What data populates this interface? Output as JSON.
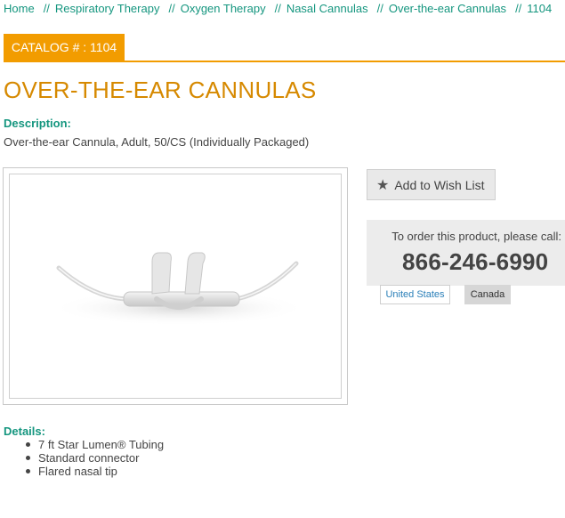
{
  "breadcrumb": {
    "items": [
      "Home",
      "Respiratory Therapy",
      "Oxygen Therapy",
      "Nasal Cannulas",
      "Over-the-ear Cannulas",
      "1104"
    ],
    "separator": "//"
  },
  "catalog": {
    "label": "CATALOG # : 1104"
  },
  "product": {
    "title": "OVER-THE-EAR CANNULAS",
    "description_label": "Description:",
    "description": "Over-the-ear Cannula, Adult, 50/CS (Individually Packaged)",
    "details_label": "Details:",
    "details": [
      "7 ft Star Lumen® Tubing",
      "Standard connector",
      "Flared nasal tip"
    ]
  },
  "wishlist": {
    "label": "Add to Wish List",
    "icon": "star-icon"
  },
  "order": {
    "prompt": "To order this product, please call:",
    "phone": "866-246-6990",
    "tabs": [
      "United States",
      "Canada"
    ]
  },
  "colors": {
    "accent": "#f29c00",
    "title": "#d68900",
    "link": "#15967f",
    "tab_link": "#2a7fb8"
  }
}
